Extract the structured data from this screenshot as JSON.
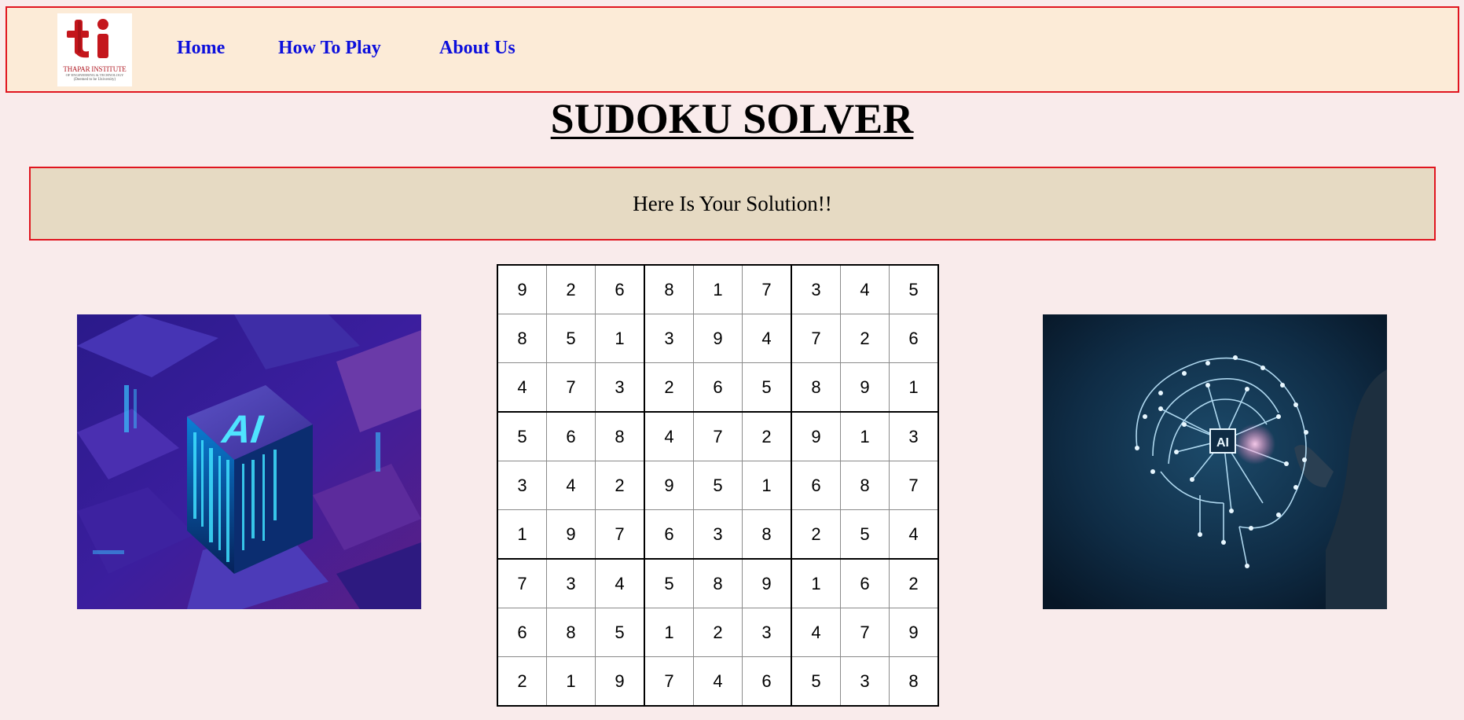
{
  "nav": {
    "logo": {
      "mark": "ti",
      "line1": "THAPAR INSTITUTE",
      "line2": "OF ENGINEERING & TECHNOLOGY",
      "line3": "(Deemed to be University)"
    },
    "links": [
      {
        "label": "Home"
      },
      {
        "label": "How To Play"
      },
      {
        "label": "About Us"
      }
    ]
  },
  "page": {
    "title": "SUDOKU SOLVER",
    "message": "Here Is Your Solution!!"
  },
  "images": {
    "left": {
      "label": "AI"
    },
    "right": {
      "label": "AI"
    }
  },
  "colors": {
    "page_background": "#f9ebeb",
    "nav_background": "#fcebd7",
    "banner_background": "#e6dac3",
    "border_red": "#e0151f",
    "link_blue": "#0c0fdc"
  },
  "sudoku": {
    "rows": [
      [
        "9",
        "2",
        "6",
        "8",
        "1",
        "7",
        "3",
        "4",
        "5"
      ],
      [
        "8",
        "5",
        "1",
        "3",
        "9",
        "4",
        "7",
        "2",
        "6"
      ],
      [
        "4",
        "7",
        "3",
        "2",
        "6",
        "5",
        "8",
        "9",
        "1"
      ],
      [
        "5",
        "6",
        "8",
        "4",
        "7",
        "2",
        "9",
        "1",
        "3"
      ],
      [
        "3",
        "4",
        "2",
        "9",
        "5",
        "1",
        "6",
        "8",
        "7"
      ],
      [
        "1",
        "9",
        "7",
        "6",
        "3",
        "8",
        "2",
        "5",
        "4"
      ],
      [
        "7",
        "3",
        "4",
        "5",
        "8",
        "9",
        "1",
        "6",
        "2"
      ],
      [
        "6",
        "8",
        "5",
        "1",
        "2",
        "3",
        "4",
        "7",
        "9"
      ],
      [
        "2",
        "1",
        "9",
        "7",
        "4",
        "6",
        "5",
        "3",
        "8"
      ]
    ]
  }
}
